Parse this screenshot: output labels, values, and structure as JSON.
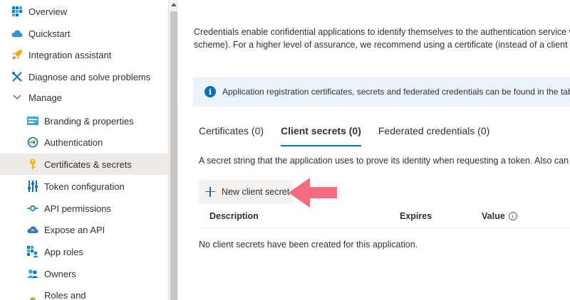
{
  "sidebar": {
    "items": [
      {
        "label": "Overview",
        "icon": "grid-icon"
      },
      {
        "label": "Quickstart",
        "icon": "cloud-icon"
      },
      {
        "label": "Integration assistant",
        "icon": "rocket-icon"
      },
      {
        "label": "Diagnose and solve problems",
        "icon": "wrench-icon"
      },
      {
        "label": "Manage",
        "icon": "chevron-down-icon"
      },
      {
        "label": "Branding & properties",
        "icon": "branding-icon"
      },
      {
        "label": "Authentication",
        "icon": "authentication-icon"
      },
      {
        "label": "Certificates & secrets",
        "icon": "key-icon"
      },
      {
        "label": "Token configuration",
        "icon": "token-icon"
      },
      {
        "label": "API permissions",
        "icon": "api-permissions-icon"
      },
      {
        "label": "Expose an API",
        "icon": "cloud-api-icon"
      },
      {
        "label": "App roles",
        "icon": "app-roles-icon"
      },
      {
        "label": "Owners",
        "icon": "owners-icon"
      },
      {
        "label": "Roles and",
        "icon": "roles-icon"
      }
    ]
  },
  "main": {
    "intro_line1": "Credentials enable confidential applications to identify themselves to the authentication service w",
    "intro_line2": "scheme). For a higher level of assurance, we recommend using a certificate (instead of a client sec",
    "info_text": "Application registration certificates, secrets and federated credentials can be found in the tabs be",
    "tabs": [
      {
        "label": "Certificates (0)"
      },
      {
        "label": "Client secrets (0)"
      },
      {
        "label": "Federated credentials (0)"
      }
    ],
    "description": "A secret string that the application uses to prove its identity when requesting a token. Also can",
    "new_button_label": "New client secret",
    "table": {
      "headers": [
        "Description",
        "Expires",
        "Value"
      ]
    },
    "empty_message": "No client secrets have been created for this application."
  },
  "colors": {
    "accent": "#0f6cbd",
    "arrow": "#f36b7f",
    "info_bg": "#ebf3fc"
  }
}
